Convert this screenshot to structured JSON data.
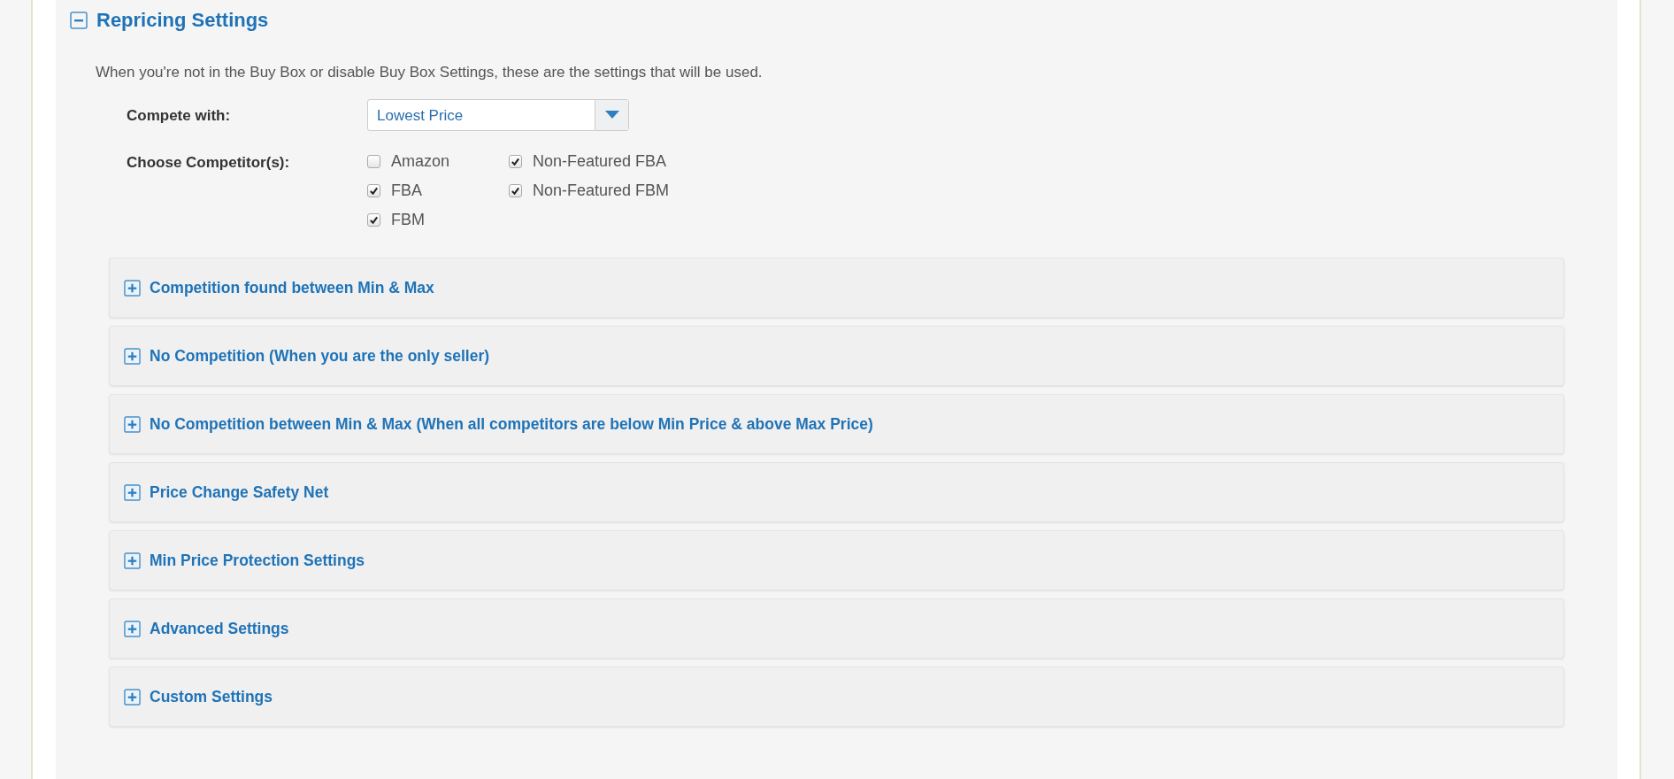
{
  "section": {
    "title": "Repricing Settings",
    "expanded": true,
    "description": "When you're not in the Buy Box or disable Buy Box Settings, these are the settings that will be used.",
    "compete_with": {
      "label": "Compete with:",
      "value": "Lowest Price"
    },
    "competitors": {
      "label": "Choose Competitor(s):",
      "options": [
        {
          "label": "Amazon",
          "checked": false
        },
        {
          "label": "FBA",
          "checked": true
        },
        {
          "label": "FBM",
          "checked": true
        },
        {
          "label": "Non-Featured FBA",
          "checked": true
        },
        {
          "label": "Non-Featured FBM",
          "checked": true
        }
      ]
    },
    "subsections": [
      {
        "title": "Competition found between Min & Max",
        "expanded": false
      },
      {
        "title": "No Competition (When you are the only seller)",
        "expanded": false
      },
      {
        "title": "No Competition between Min & Max (When all competitors are below Min Price & above Max Price)",
        "expanded": false
      },
      {
        "title": "Price Change Safety Net",
        "expanded": false
      },
      {
        "title": "Min Price Protection Settings",
        "expanded": false
      },
      {
        "title": "Advanced Settings",
        "expanded": false
      },
      {
        "title": "Custom Settings",
        "expanded": false
      }
    ]
  }
}
